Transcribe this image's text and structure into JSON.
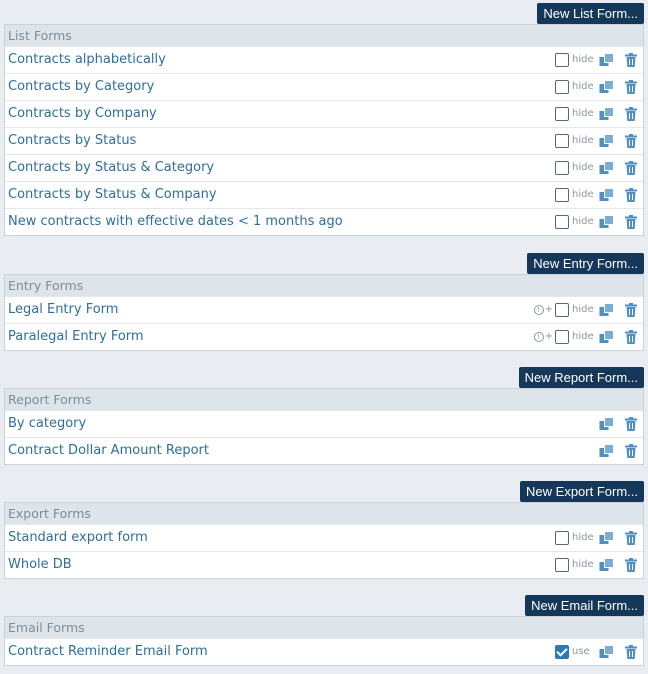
{
  "list_forms": {
    "button": "New List Form...",
    "header": "List Forms",
    "rows": [
      {
        "label": "Contracts alphabetically",
        "option": "hide"
      },
      {
        "label": "Contracts by Category",
        "option": "hide"
      },
      {
        "label": "Contracts by Company",
        "option": "hide"
      },
      {
        "label": "Contracts by Status",
        "option": "hide"
      },
      {
        "label": "Contracts by Status & Category",
        "option": "hide"
      },
      {
        "label": "Contracts by Status & Company",
        "option": "hide"
      },
      {
        "label": "New contracts with effective dates < 1 months ago",
        "option": "hide"
      }
    ]
  },
  "entry_forms": {
    "button": "New Entry Form...",
    "header": "Entry Forms",
    "rows": [
      {
        "label": "Legal Entry Form",
        "plus": "+",
        "option": "hide"
      },
      {
        "label": "Paralegal Entry Form",
        "plus": "+",
        "option": "hide"
      }
    ]
  },
  "report_forms": {
    "button": "New Report Form...",
    "header": "Report Forms",
    "rows": [
      {
        "label": "By category"
      },
      {
        "label": "Contract Dollar Amount Report"
      }
    ]
  },
  "export_forms": {
    "button": "New Export Form...",
    "header": "Export Forms",
    "rows": [
      {
        "label": "Standard export form",
        "option": "hide"
      },
      {
        "label": "Whole DB",
        "option": "hide"
      }
    ]
  },
  "email_forms": {
    "button": "New Email Form...",
    "header": "Email Forms",
    "rows": [
      {
        "label": "Contract Reminder Email Form",
        "option": "use",
        "checked": true
      }
    ]
  },
  "colors": {
    "button_bg": "#15375a",
    "link": "#2e6f9a",
    "header_bg": "#dde4ea",
    "page_bg": "#e9edf1"
  }
}
